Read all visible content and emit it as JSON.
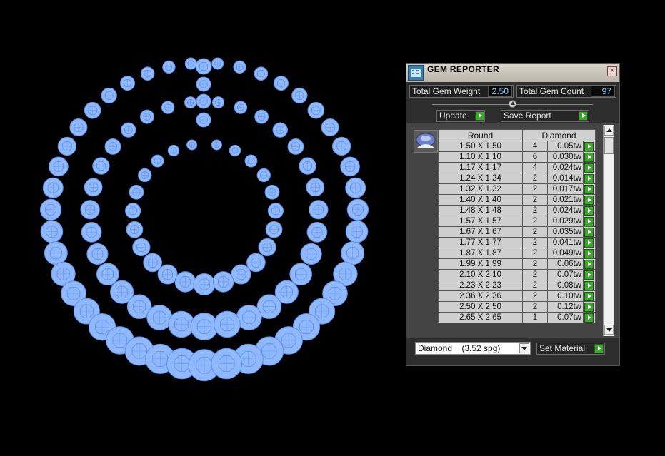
{
  "panel": {
    "title": "GEM REPORTER",
    "close_icon": "close-icon",
    "total_weight_label": "Total Gem Weight",
    "total_weight_value": "2.50",
    "total_count_label": "Total Gem Count",
    "total_count_value": "97",
    "update_label": "Update",
    "save_report_label": "Save Report",
    "table": {
      "header_shape": "Round",
      "header_material": "Diamond",
      "rows": [
        {
          "size": "1.50 X 1.50",
          "count": "4",
          "weight": "0.05tw"
        },
        {
          "size": "1.10 X 1.10",
          "count": "6",
          "weight": "0.030tw"
        },
        {
          "size": "1.17 X 1.17",
          "count": "4",
          "weight": "0.024tw"
        },
        {
          "size": "1.24 X 1.24",
          "count": "2",
          "weight": "0.014tw"
        },
        {
          "size": "1.32 X 1.32",
          "count": "2",
          "weight": "0.017tw"
        },
        {
          "size": "1.40 X 1.40",
          "count": "2",
          "weight": "0.021tw"
        },
        {
          "size": "1.48 X 1.48",
          "count": "2",
          "weight": "0.024tw"
        },
        {
          "size": "1.57 X 1.57",
          "count": "2",
          "weight": "0.029tw"
        },
        {
          "size": "1.67 X 1.67",
          "count": "2",
          "weight": "0.035tw"
        },
        {
          "size": "1.77 X 1.77",
          "count": "2",
          "weight": "0.041tw"
        },
        {
          "size": "1.87 X 1.87",
          "count": "2",
          "weight": "0.049tw"
        },
        {
          "size": "1.99 X 1.99",
          "count": "2",
          "weight": "0.06tw"
        },
        {
          "size": "2.10 X 2.10",
          "count": "2",
          "weight": "0.07tw"
        },
        {
          "size": "2.23 X 2.23",
          "count": "2",
          "weight": "0.08tw"
        },
        {
          "size": "2.36 X 2.36",
          "count": "2",
          "weight": "0.10tw"
        },
        {
          "size": "2.50 X 2.50",
          "count": "2",
          "weight": "0.12tw"
        },
        {
          "size": "2.65 X 2.65",
          "count": "1",
          "weight": "0.07tw"
        }
      ]
    },
    "material_value": "Diamond    (3.52 spg)",
    "set_material_label": "Set Material"
  },
  "colors": {
    "gem_fill": "#8fb8ff",
    "gem_stroke": "#5b8fe8",
    "accent_green": "#3fa531",
    "value_text": "#7fd2ff"
  }
}
